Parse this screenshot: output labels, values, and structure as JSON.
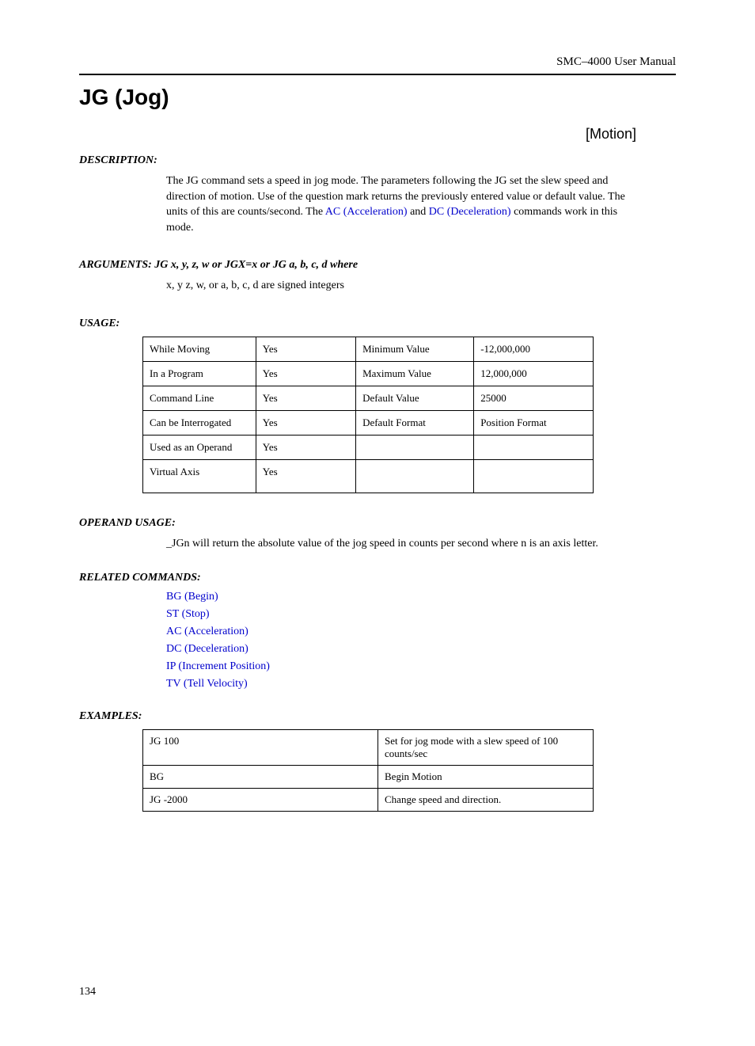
{
  "header": "SMC–4000 User Manual",
  "title": "JG (Jog)",
  "category": "[Motion]",
  "labels": {
    "description": "DESCRIPTION:",
    "arguments": "ARGUMENTS:  JG x, y, z, w or JGX=x  or JG a, b, c, d    where",
    "usage": "USAGE:",
    "operand": "OPERAND USAGE:",
    "related": "RELATED COMMANDS:",
    "examples": "EXAMPLES:"
  },
  "description": {
    "part1": "The JG command sets a speed in jog mode. The parameters following the JG set the slew speed and direction of motion. Use of the question mark returns the previously entered value or default value. The units of this are counts/second. The ",
    "link1": "AC (Acceleration)",
    "mid": " and ",
    "link2": "DC (Deceleration)",
    "part2": " commands work in this mode."
  },
  "arguments_body": "x, y z, w, or a, b, c, d are signed integers",
  "usage_table": [
    [
      "While Moving",
      "Yes",
      "Minimum Value",
      "-12,000,000"
    ],
    [
      "In a Program",
      "Yes",
      "Maximum Value",
      "12,000,000"
    ],
    [
      "Command Line",
      "Yes",
      "Default Value",
      "25000"
    ],
    [
      "Can be Interrogated",
      "Yes",
      "Default Format",
      "Position Format"
    ],
    [
      "Used as an Operand",
      "Yes",
      "",
      ""
    ],
    [
      "Virtual Axis",
      "Yes",
      "",
      ""
    ]
  ],
  "operand_body": "_JGn will return the absolute value of the jog speed in counts per second where n is an axis letter.",
  "related_commands": [
    "BG (Begin)",
    "ST (Stop)",
    "AC (Acceleration)",
    "DC (Deceleration)",
    "IP (Increment Position)",
    "TV (Tell Velocity)"
  ],
  "examples_table": [
    [
      "JG 100",
      "Set for jog mode with a slew speed of 100 counts/sec"
    ],
    [
      "BG",
      "Begin Motion"
    ],
    [
      "JG -2000",
      "Change speed and direction."
    ]
  ],
  "page_number": "134"
}
